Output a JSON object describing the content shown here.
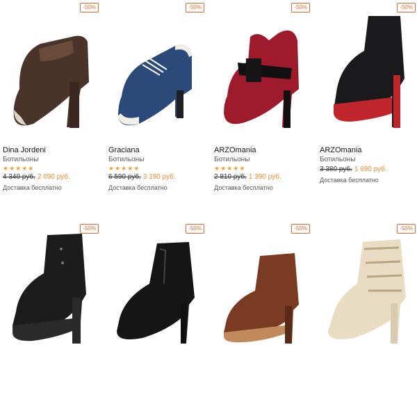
{
  "products": [
    {
      "badge": "-50%",
      "brand": "Dina Jordeni",
      "type": "Ботильоны",
      "stars": "★★★★★",
      "old_price": "4 340 руб.",
      "new_price": "2 090 руб.",
      "shipping": "Доставка бесплатно",
      "shoe_icon": "bootie-brown-suede",
      "colors": {
        "body": "#4a342a",
        "accent": "#8b5a3c",
        "heel": "#3a2820",
        "tip": "#d9d4c8"
      }
    },
    {
      "badge": "-50%",
      "brand": "Graciana",
      "type": "Ботильоны",
      "stars": "★★★★★",
      "old_price": "6 590 руб.",
      "new_price": "3 190 руб.",
      "shipping": "Доставка бесплатно",
      "shoe_icon": "oxford-bootie-blue",
      "colors": {
        "body": "#2b4a7a",
        "accent": "#f2efe6",
        "heel": "#1f1f24",
        "tip": "#f2efe6"
      }
    },
    {
      "badge": "-50%",
      "brand": "ARZOmania",
      "type": "Ботильоны",
      "stars": "★★★★★",
      "old_price": "2 810 руб.",
      "new_price": "1 390 руб.",
      "shipping": "Доставка бесплатно",
      "shoe_icon": "bootie-red-patent",
      "colors": {
        "body": "#9e1b2b",
        "accent": "#111111",
        "heel": "#111111",
        "tip": "#9e1b2b"
      }
    },
    {
      "badge": "-50%",
      "brand": "ARZOmania",
      "type": "Ботильоны",
      "stars": "",
      "old_price": "3 380 руб.",
      "new_price": "1 690 руб.",
      "shipping": "Доставка бесплатно",
      "shoe_icon": "ankle-boot-black-red-platform",
      "colors": {
        "body": "#1a1a1c",
        "accent": "#c0262c",
        "heel": "#c0262c",
        "tip": "#c0262c"
      }
    },
    {
      "badge": "-50%",
      "brand": "",
      "type": "",
      "stars": "",
      "old_price": "",
      "new_price": "",
      "shipping": "",
      "shoe_icon": "lace-up-boot-black",
      "colors": {
        "body": "#1c1c1c",
        "accent": "#3a3a3a",
        "heel": "#2a2a2a",
        "tip": "#1c1c1c"
      }
    },
    {
      "badge": "-50%",
      "brand": "",
      "type": "",
      "stars": "",
      "old_price": "",
      "new_price": "",
      "shipping": "",
      "shoe_icon": "ankle-boot-black-leather",
      "colors": {
        "body": "#151515",
        "accent": "#444444",
        "heel": "#111111",
        "tip": "#151515"
      }
    },
    {
      "badge": "-50%",
      "brand": "",
      "type": "",
      "stars": "",
      "old_price": "",
      "new_price": "",
      "shipping": "",
      "shoe_icon": "ankle-boot-cognac",
      "colors": {
        "body": "#7a3b22",
        "accent": "#b9894e",
        "heel": "#5a2a18",
        "tip": "#c08a5a"
      }
    },
    {
      "badge": "-50%",
      "brand": "",
      "type": "",
      "stars": "",
      "old_price": "",
      "new_price": "",
      "shipping": "",
      "shoe_icon": "cutout-bootie-beige",
      "colors": {
        "body": "#e8dcc3",
        "accent": "#b8a47e",
        "heel": "#d9cbb0",
        "tip": "#e8dcc3"
      }
    }
  ]
}
